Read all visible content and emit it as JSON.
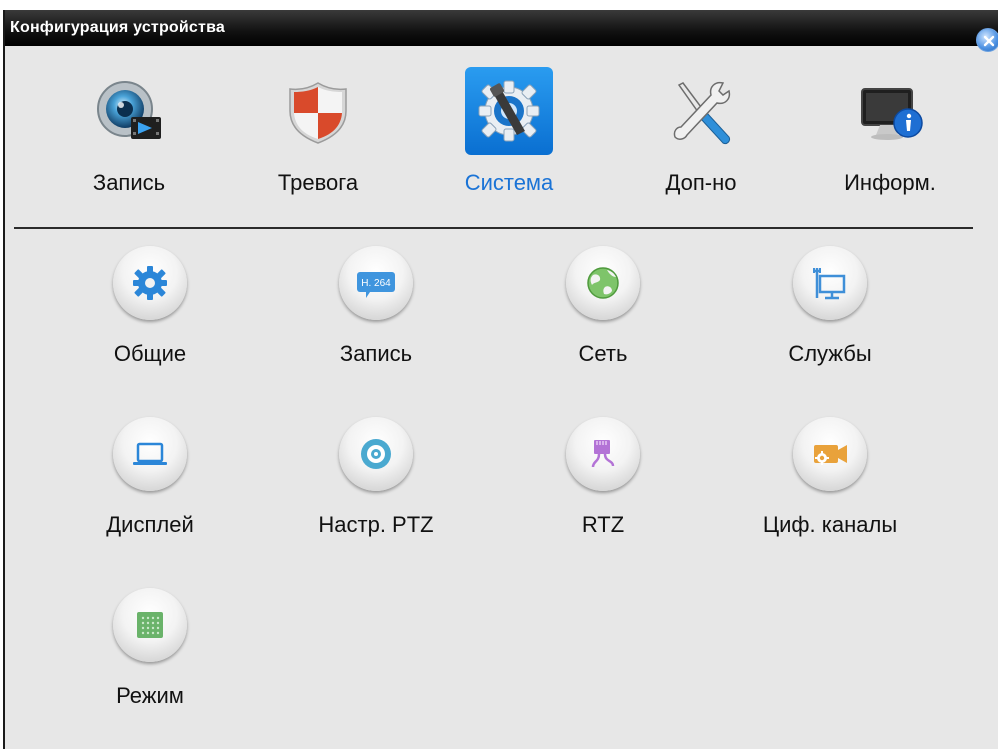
{
  "window": {
    "title": "Конфигурация устройства"
  },
  "tabs": [
    {
      "label": "Запись",
      "icon": "record-camera-icon",
      "active": false
    },
    {
      "label": "Тревога",
      "icon": "alarm-shield-icon",
      "active": false
    },
    {
      "label": "Система",
      "icon": "system-gear-wrench-icon",
      "active": true
    },
    {
      "label": "Доп-но",
      "icon": "tools-icon",
      "active": false
    },
    {
      "label": "Информ.",
      "icon": "info-monitor-icon",
      "active": false
    }
  ],
  "items": [
    {
      "label": "Общие",
      "icon": "gear-icon"
    },
    {
      "label": "Запись",
      "icon": "h264-icon",
      "icon_text": "H. 264"
    },
    {
      "label": "Сеть",
      "icon": "globe-icon"
    },
    {
      "label": "Службы",
      "icon": "network-services-icon"
    },
    {
      "label": "Дисплей",
      "icon": "laptop-display-icon"
    },
    {
      "label": "Настр. PTZ",
      "icon": "ptz-camera-icon"
    },
    {
      "label": "RTZ",
      "icon": "rs485-connector-icon"
    },
    {
      "label": "Циф. каналы",
      "icon": "digital-channel-camera-icon"
    },
    {
      "label": "Режим",
      "icon": "mode-grid-icon"
    }
  ],
  "colors": {
    "active_tab": "#1a73d6",
    "title_bar": "#111111",
    "panel_bg": "#e7e7e7"
  }
}
